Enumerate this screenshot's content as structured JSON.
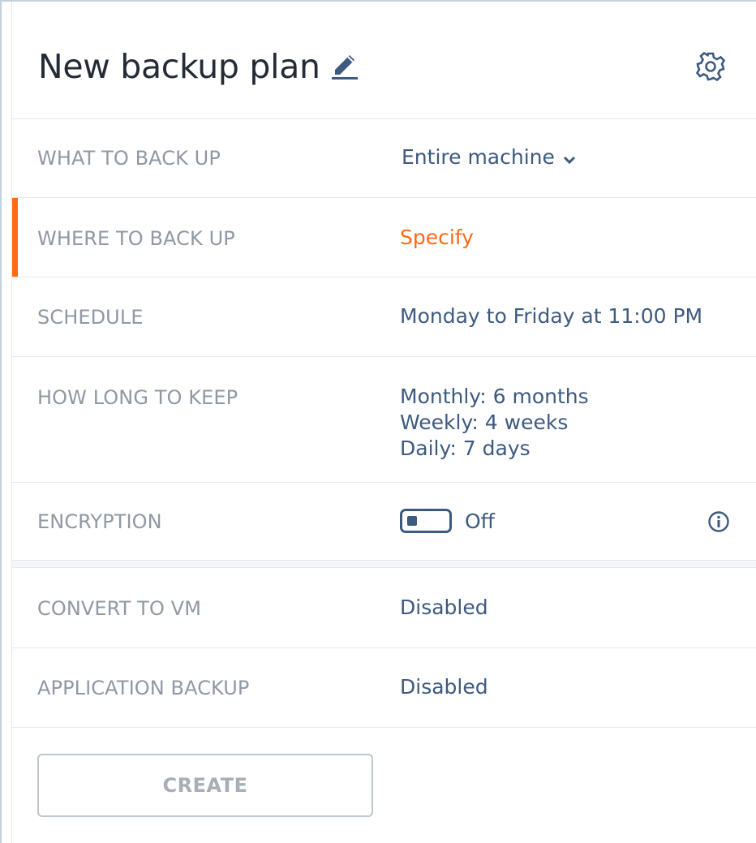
{
  "header": {
    "title": "New backup plan",
    "edit_icon": "pencil-icon",
    "settings_icon": "gear-icon"
  },
  "rows": {
    "what": {
      "label": "WHAT TO BACK UP",
      "value": "Entire machine",
      "icon": "chevron-down-icon"
    },
    "where": {
      "label": "WHERE TO BACK UP",
      "value": "Specify"
    },
    "schedule": {
      "label": "SCHEDULE",
      "value": "Monday to Friday at 11:00 PM"
    },
    "keep": {
      "label": "HOW LONG TO KEEP",
      "lines": [
        "Monthly: 6 months",
        "Weekly: 4 weeks",
        "Daily: 7 days"
      ]
    },
    "encryption": {
      "label": "ENCRYPTION",
      "value": "Off",
      "enabled": false,
      "info_icon": "info-icon"
    },
    "convert": {
      "label": "CONVERT TO VM",
      "value": "Disabled"
    },
    "application": {
      "label": "APPLICATION BACKUP",
      "value": "Disabled"
    }
  },
  "actions": {
    "create_label": "CREATE"
  },
  "colors": {
    "accent": "#ff6a13",
    "value_text": "#3d5a80",
    "label_text": "#9098a3",
    "title_text": "#242b36"
  }
}
